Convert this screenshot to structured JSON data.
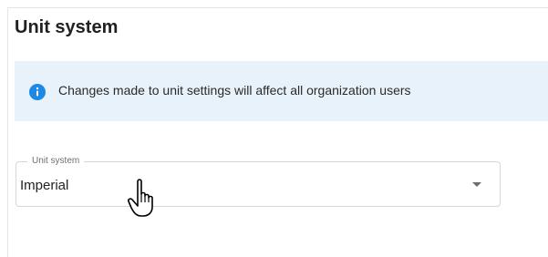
{
  "page": {
    "title": "Unit system"
  },
  "banner": {
    "icon": "info-icon",
    "message": "Changes made to unit settings will affect all organization users"
  },
  "unit_select": {
    "label": "Unit system",
    "value": "Imperial",
    "icon": "chevron-down-icon"
  },
  "cursor": {
    "icon": "hand-pointer-cursor-icon"
  },
  "colors": {
    "banner_bg": "#e8f2fb",
    "info_icon": "#1e88e5",
    "border": "#d6d6d6"
  }
}
